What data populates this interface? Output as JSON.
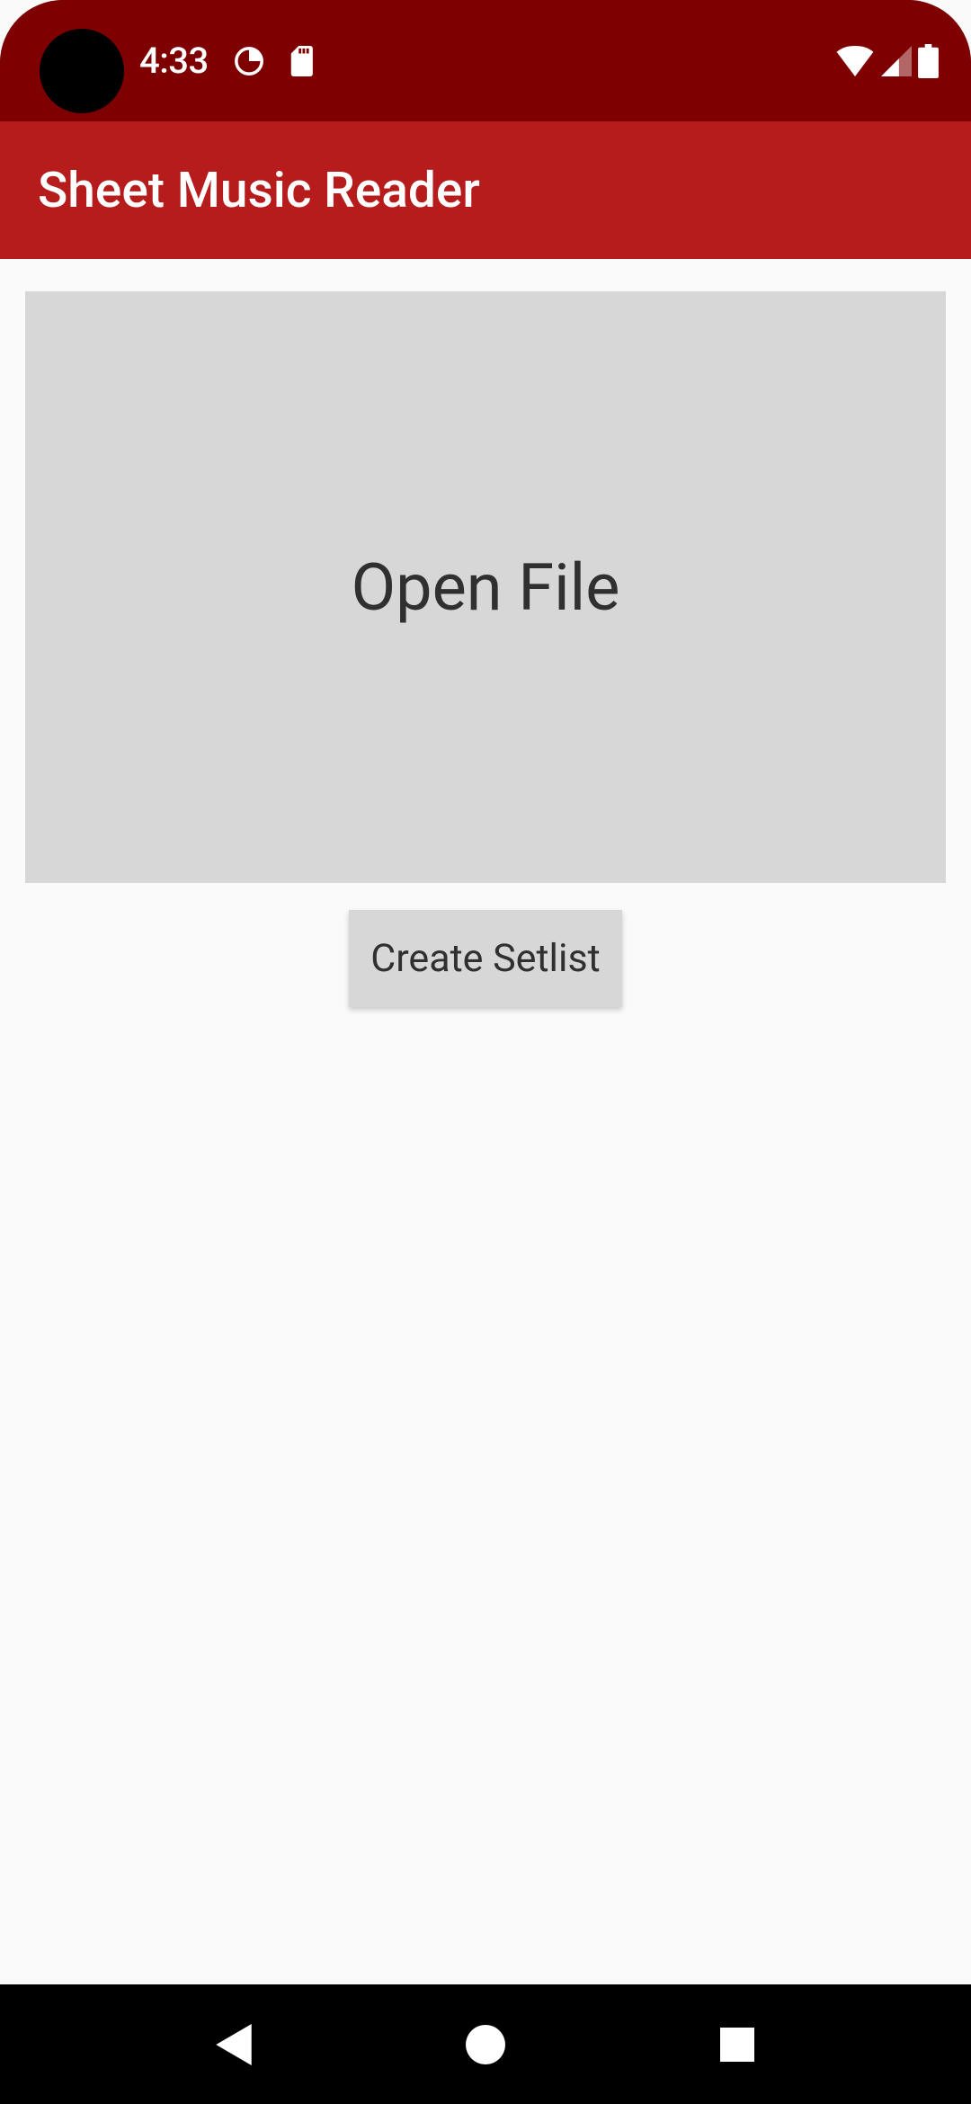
{
  "status_bar": {
    "time": "4:33"
  },
  "app_bar": {
    "title": "Sheet Music Reader"
  },
  "main": {
    "open_file_label": "Open File",
    "create_setlist_label": "Create Setlist"
  }
}
